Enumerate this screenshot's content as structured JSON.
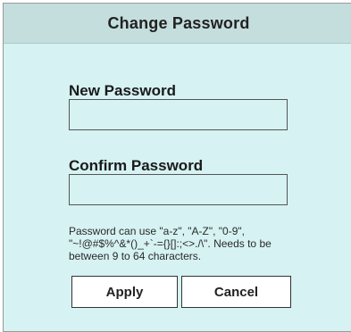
{
  "dialog": {
    "title": "Change Password",
    "new_password_label": "New Password",
    "new_password_value": "",
    "confirm_password_label": "Confirm Password",
    "confirm_password_value": "",
    "hint": "Password can use \"a-z\", \"A-Z\", \"0-9\", \"~!@#$%^&*()_+`-={}[]:;<>./\\\". Needs to be between 9 to 64 characters.",
    "apply_label": "Apply",
    "cancel_label": "Cancel"
  },
  "colors": {
    "background": "#d6f2f2",
    "titlebar": "#c4dedd"
  }
}
